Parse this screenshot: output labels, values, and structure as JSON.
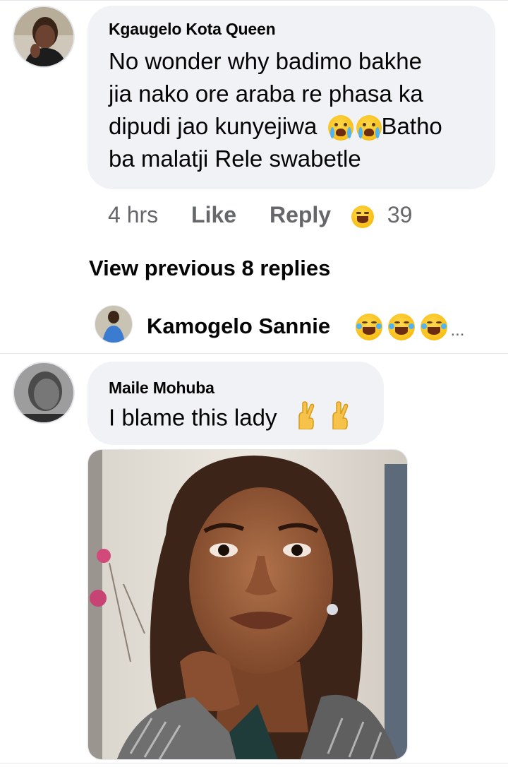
{
  "comments": [
    {
      "author": "Kgaugelo Kota Queen",
      "lines": [
        "No wonder why badimo bakhe",
        "jia nako ore araba re phasa ka",
        "dipudi jao kunyejiwa",
        "Batho",
        "ba malatji Rele swabetle"
      ],
      "emoji_inline": [
        "crying-face-icon",
        "crying-face-icon"
      ],
      "time": "4 hrs",
      "like_label": "Like",
      "reply_label": "Reply",
      "reaction_icon": "laughing-face-icon",
      "reaction_count": "39"
    },
    {
      "author": "Maile Mohuba",
      "text": "I blame this lady",
      "emoji_inline": [
        "crossed-fingers-icon",
        "crossed-fingers-icon"
      ],
      "attachment": "photo-of-woman"
    }
  ],
  "view_previous_label": "View previous 8 replies",
  "reply_preview": {
    "author": "Kamogelo Sannie",
    "emoji": [
      "tears-of-joy-icon",
      "tears-of-joy-icon",
      "tears-of-joy-icon"
    ],
    "ellipsis": "..."
  },
  "colors": {
    "bubble": "#f0f2f5",
    "meta_text": "#65676b",
    "text": "#050505"
  }
}
